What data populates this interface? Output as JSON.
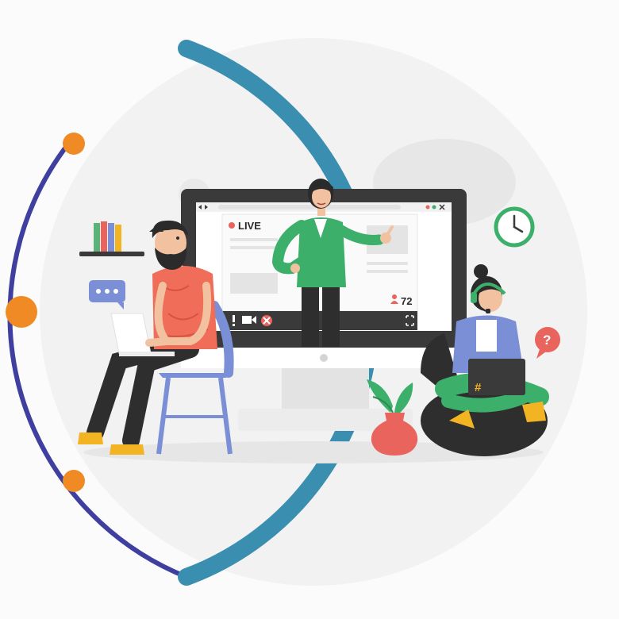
{
  "stream": {
    "live_label": "LIVE",
    "viewer_count": "72"
  },
  "laptop": {
    "hashtag": "#"
  },
  "question_bubble": {
    "symbol": "?"
  },
  "colors": {
    "ring_teal": "#3a8fb0",
    "ring_navy": "#3f3fa0",
    "dot_orange": "#f08a24",
    "monitor": "#3a3a3a",
    "presenter_shirt": "#3cb06b",
    "man_shirt": "#f06d5a",
    "woman_hoodie": "#7a8fd6",
    "beanbag": "#2e2e2e",
    "plant_pot": "#e8645c",
    "clock": "#3cb06b"
  }
}
